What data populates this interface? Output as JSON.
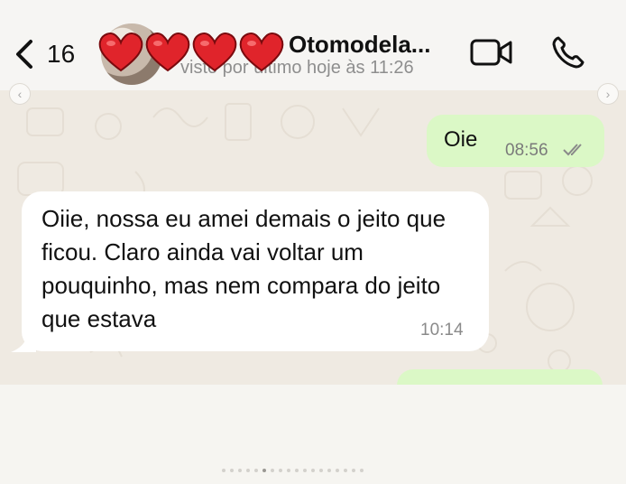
{
  "header": {
    "back_count": "16",
    "contact_name": "Otomodela...",
    "status": "visto por último hoje às 11:26"
  },
  "messages": [
    {
      "direction": "out",
      "text": "Oie",
      "time": "08:56",
      "status": "read"
    },
    {
      "direction": "in",
      "text": "Oiie, nossa eu amei demais o jeito que ficou. Claro ainda vai voltar um pouquinho, mas nem compara do jeito que estava",
      "time": "10:14"
    }
  ],
  "colors": {
    "outgoing_bubble": "#dbf8c6",
    "incoming_bubble": "#ffffff",
    "chat_background": "#efeae2",
    "heart": "#e0242b"
  },
  "icons": [
    "back-chevron-icon",
    "video-call-icon",
    "voice-call-icon",
    "read-ticks-icon",
    "heart-sticker-icon"
  ],
  "carousel": {
    "slide_count": 18,
    "active_slide": 6
  }
}
